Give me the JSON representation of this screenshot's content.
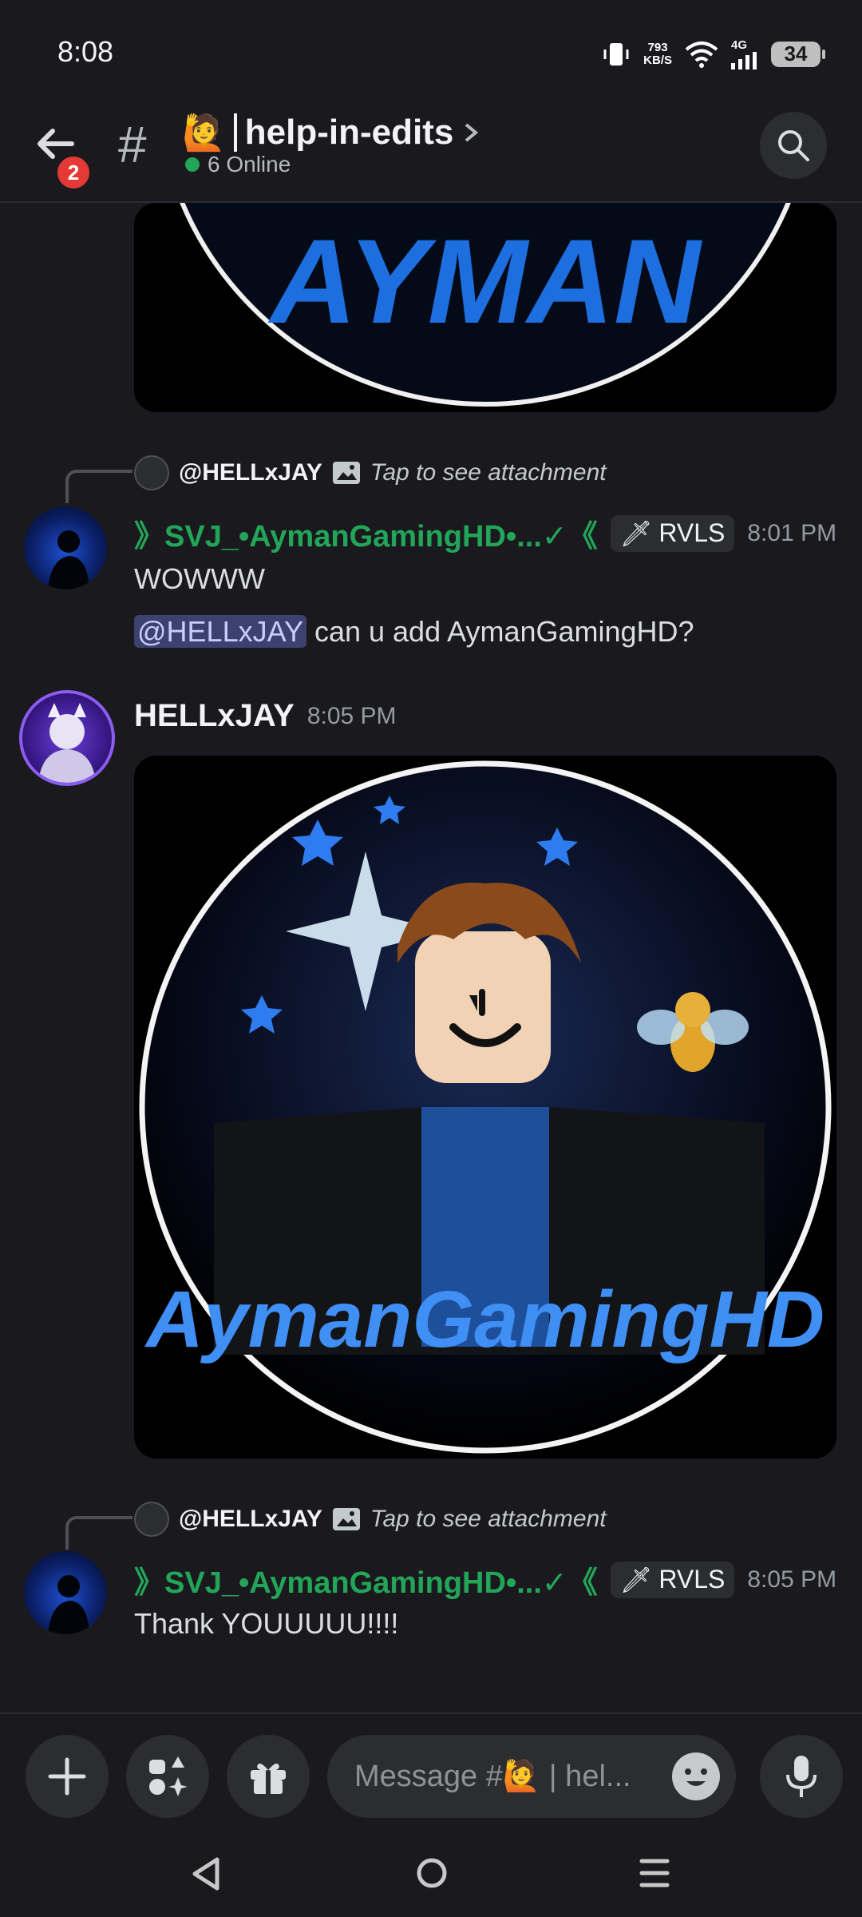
{
  "status": {
    "time": "8:08",
    "net_speed": "793",
    "net_unit": "KB/S",
    "network": "4G",
    "battery": "34"
  },
  "header": {
    "back_badge": "2",
    "channel_emoji": "🙋",
    "channel_name": "help-in-edits",
    "online_text": "6 Online"
  },
  "messages": {
    "top_image_text": "AYMAN",
    "m1": {
      "reply_name": "@HELLxJAY",
      "reply_hint": "Tap to see attachment",
      "author": "》SVJ_•AymanGamingHD•...✓《",
      "role": "RVLS",
      "time": "8:01 PM",
      "line1": "WOWWW",
      "mention": "@HELLxJAY",
      "line2_rest": " can u add AymanGamingHD?"
    },
    "m2": {
      "author": "HELLxJAY",
      "time": "8:05 PM",
      "image_text": "AymanGamingHD"
    },
    "m3": {
      "reply_name": "@HELLxJAY",
      "reply_hint": "Tap to see attachment",
      "author": "》SVJ_•AymanGamingHD•...✓《",
      "role": "RVLS",
      "time": "8:05 PM",
      "line1": "Thank YOUUUUU!!!!"
    }
  },
  "composer": {
    "placeholder": "Message #🙋 | hel..."
  },
  "colors": {
    "accent_green": "#23a559",
    "mention_bg": "#3c4270",
    "online": "#23a559"
  }
}
